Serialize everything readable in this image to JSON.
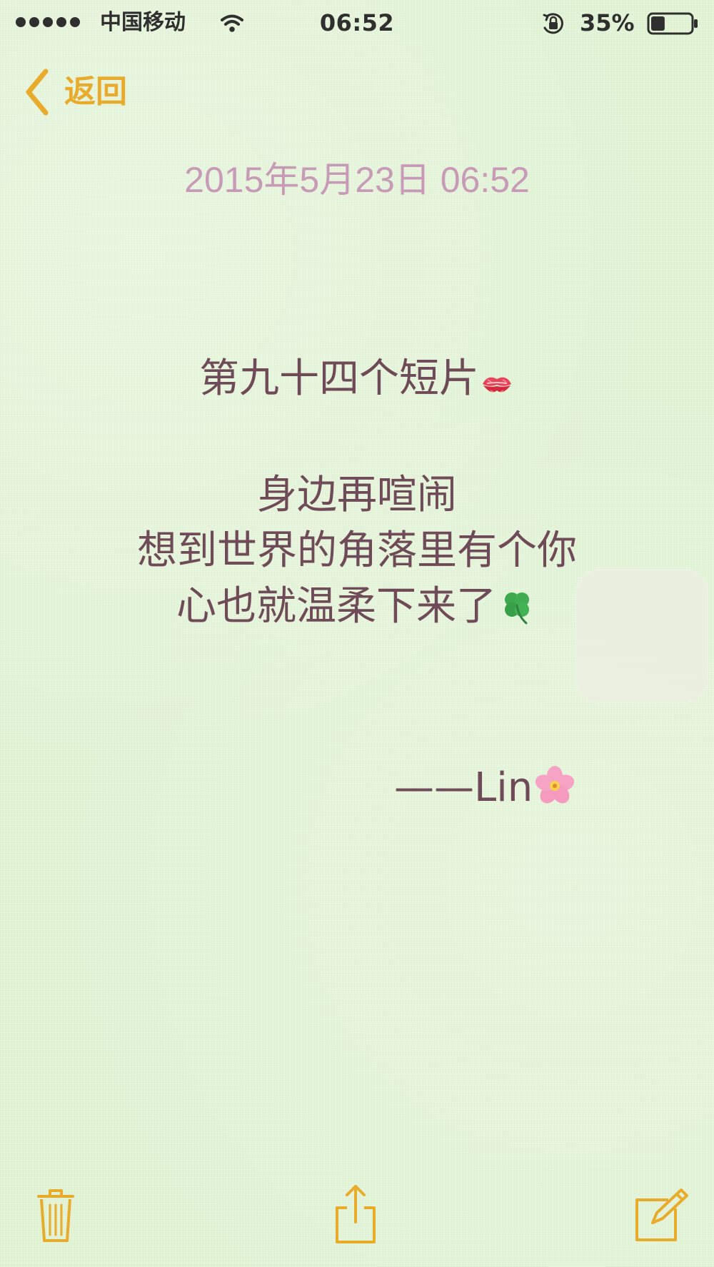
{
  "status_bar": {
    "carrier": "中国移动",
    "time": "06:52",
    "battery_percent": "35%",
    "battery_level": 0.35,
    "icons": [
      "signal-dots",
      "wifi-icon",
      "orientation-lock-icon",
      "battery-icon"
    ]
  },
  "nav": {
    "back_label": "返回"
  },
  "note": {
    "date": "2015年5月23日 06:52",
    "title": "第九十四个短片",
    "lines": [
      "身边再喧闹",
      "想到世界的角落里有个你",
      "心也就温柔下来了"
    ],
    "signature": "——Lin",
    "emojis": [
      "kiss-mark-emoji",
      "four-leaf-clover-emoji",
      "cherry-blossom-emoji"
    ]
  },
  "toolbar": {
    "icons": [
      "trash-icon",
      "share-icon",
      "compose-icon"
    ]
  },
  "colors": {
    "accent": "#e8ab2c",
    "date": "#c79bb7",
    "text": "#6f4a58",
    "paper": "#e3f4d7"
  }
}
